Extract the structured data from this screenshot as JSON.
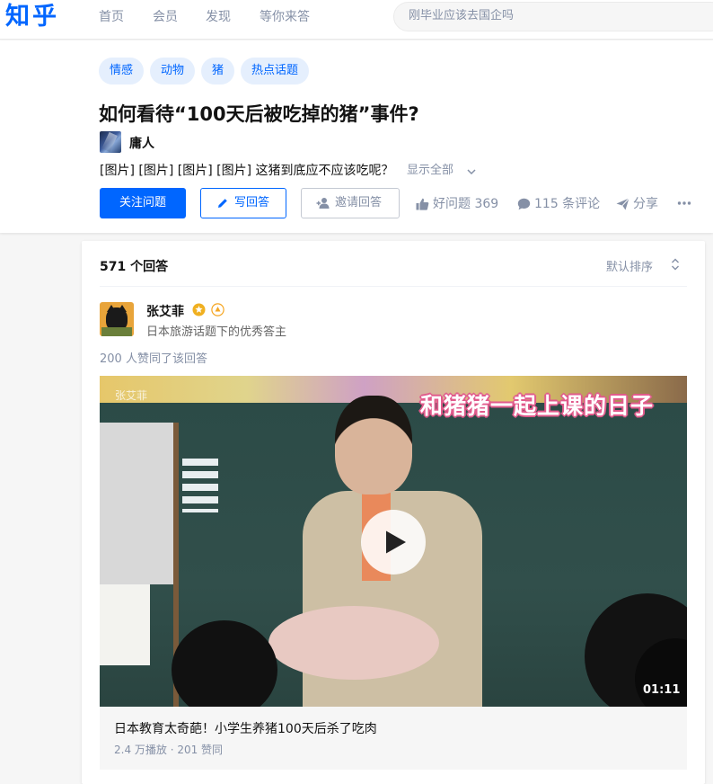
{
  "nav": {
    "logo": "知乎",
    "links": [
      "首页",
      "会员",
      "发现",
      "等你来答"
    ],
    "search_placeholder": "刚毕业应该去国企吗"
  },
  "question": {
    "topics": [
      "情感",
      "动物",
      "猪",
      "热点话题"
    ],
    "title": "如何看待“100天后被吃掉的猪”事件?",
    "author": "庸人",
    "description": "[图片] [图片] [图片] [图片] 这猪到底应不应该吃呢？",
    "show_all": "显示全部",
    "follow_label": "关注问题",
    "write_label": "写回答",
    "invite_label": "邀请回答",
    "good_question": "好问题 369",
    "comments": "115 条评论",
    "share": "分享"
  },
  "answers": {
    "count_label": "571 个回答",
    "sort_label": "默认排序"
  },
  "answer": {
    "author_name": "张艾菲",
    "author_bio": "日本旅游话题下的优秀答主",
    "vote_info": "200 人赞同了该回答",
    "video": {
      "watermark": "张艾菲",
      "caption": "和猪猪一起上课的日子",
      "duration": "01:11",
      "title": "日本教育太奇葩！小学生养猪100天后杀了吃肉",
      "stats": "2.4 万播放 · 201 赞同"
    }
  },
  "colors": {
    "brand": "#0066ff",
    "topic_bg": "#e5effd",
    "muted": "#8590a6",
    "caption_outline": "#e15b8c"
  }
}
